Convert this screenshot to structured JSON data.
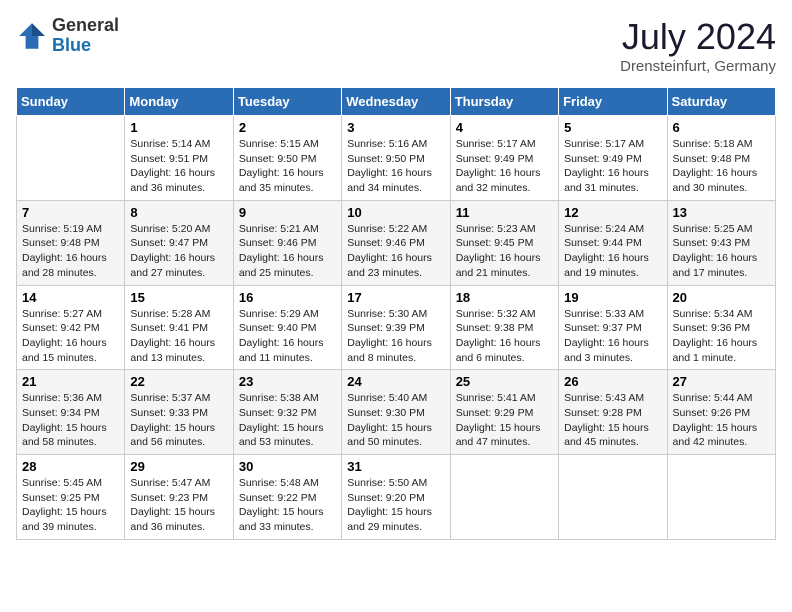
{
  "header": {
    "logo_general": "General",
    "logo_blue": "Blue",
    "month_year": "July 2024",
    "location": "Drensteinfurt, Germany"
  },
  "days_of_week": [
    "Sunday",
    "Monday",
    "Tuesday",
    "Wednesday",
    "Thursday",
    "Friday",
    "Saturday"
  ],
  "weeks": [
    [
      {
        "day": "",
        "info": ""
      },
      {
        "day": "1",
        "info": "Sunrise: 5:14 AM\nSunset: 9:51 PM\nDaylight: 16 hours and 36 minutes."
      },
      {
        "day": "2",
        "info": "Sunrise: 5:15 AM\nSunset: 9:50 PM\nDaylight: 16 hours and 35 minutes."
      },
      {
        "day": "3",
        "info": "Sunrise: 5:16 AM\nSunset: 9:50 PM\nDaylight: 16 hours and 34 minutes."
      },
      {
        "day": "4",
        "info": "Sunrise: 5:17 AM\nSunset: 9:49 PM\nDaylight: 16 hours and 32 minutes."
      },
      {
        "day": "5",
        "info": "Sunrise: 5:17 AM\nSunset: 9:49 PM\nDaylight: 16 hours and 31 minutes."
      },
      {
        "day": "6",
        "info": "Sunrise: 5:18 AM\nSunset: 9:48 PM\nDaylight: 16 hours and 30 minutes."
      }
    ],
    [
      {
        "day": "7",
        "info": "Sunrise: 5:19 AM\nSunset: 9:48 PM\nDaylight: 16 hours and 28 minutes."
      },
      {
        "day": "8",
        "info": "Sunrise: 5:20 AM\nSunset: 9:47 PM\nDaylight: 16 hours and 27 minutes."
      },
      {
        "day": "9",
        "info": "Sunrise: 5:21 AM\nSunset: 9:46 PM\nDaylight: 16 hours and 25 minutes."
      },
      {
        "day": "10",
        "info": "Sunrise: 5:22 AM\nSunset: 9:46 PM\nDaylight: 16 hours and 23 minutes."
      },
      {
        "day": "11",
        "info": "Sunrise: 5:23 AM\nSunset: 9:45 PM\nDaylight: 16 hours and 21 minutes."
      },
      {
        "day": "12",
        "info": "Sunrise: 5:24 AM\nSunset: 9:44 PM\nDaylight: 16 hours and 19 minutes."
      },
      {
        "day": "13",
        "info": "Sunrise: 5:25 AM\nSunset: 9:43 PM\nDaylight: 16 hours and 17 minutes."
      }
    ],
    [
      {
        "day": "14",
        "info": "Sunrise: 5:27 AM\nSunset: 9:42 PM\nDaylight: 16 hours and 15 minutes."
      },
      {
        "day": "15",
        "info": "Sunrise: 5:28 AM\nSunset: 9:41 PM\nDaylight: 16 hours and 13 minutes."
      },
      {
        "day": "16",
        "info": "Sunrise: 5:29 AM\nSunset: 9:40 PM\nDaylight: 16 hours and 11 minutes."
      },
      {
        "day": "17",
        "info": "Sunrise: 5:30 AM\nSunset: 9:39 PM\nDaylight: 16 hours and 8 minutes."
      },
      {
        "day": "18",
        "info": "Sunrise: 5:32 AM\nSunset: 9:38 PM\nDaylight: 16 hours and 6 minutes."
      },
      {
        "day": "19",
        "info": "Sunrise: 5:33 AM\nSunset: 9:37 PM\nDaylight: 16 hours and 3 minutes."
      },
      {
        "day": "20",
        "info": "Sunrise: 5:34 AM\nSunset: 9:36 PM\nDaylight: 16 hours and 1 minute."
      }
    ],
    [
      {
        "day": "21",
        "info": "Sunrise: 5:36 AM\nSunset: 9:34 PM\nDaylight: 15 hours and 58 minutes."
      },
      {
        "day": "22",
        "info": "Sunrise: 5:37 AM\nSunset: 9:33 PM\nDaylight: 15 hours and 56 minutes."
      },
      {
        "day": "23",
        "info": "Sunrise: 5:38 AM\nSunset: 9:32 PM\nDaylight: 15 hours and 53 minutes."
      },
      {
        "day": "24",
        "info": "Sunrise: 5:40 AM\nSunset: 9:30 PM\nDaylight: 15 hours and 50 minutes."
      },
      {
        "day": "25",
        "info": "Sunrise: 5:41 AM\nSunset: 9:29 PM\nDaylight: 15 hours and 47 minutes."
      },
      {
        "day": "26",
        "info": "Sunrise: 5:43 AM\nSunset: 9:28 PM\nDaylight: 15 hours and 45 minutes."
      },
      {
        "day": "27",
        "info": "Sunrise: 5:44 AM\nSunset: 9:26 PM\nDaylight: 15 hours and 42 minutes."
      }
    ],
    [
      {
        "day": "28",
        "info": "Sunrise: 5:45 AM\nSunset: 9:25 PM\nDaylight: 15 hours and 39 minutes."
      },
      {
        "day": "29",
        "info": "Sunrise: 5:47 AM\nSunset: 9:23 PM\nDaylight: 15 hours and 36 minutes."
      },
      {
        "day": "30",
        "info": "Sunrise: 5:48 AM\nSunset: 9:22 PM\nDaylight: 15 hours and 33 minutes."
      },
      {
        "day": "31",
        "info": "Sunrise: 5:50 AM\nSunset: 9:20 PM\nDaylight: 15 hours and 29 minutes."
      },
      {
        "day": "",
        "info": ""
      },
      {
        "day": "",
        "info": ""
      },
      {
        "day": "",
        "info": ""
      }
    ]
  ]
}
